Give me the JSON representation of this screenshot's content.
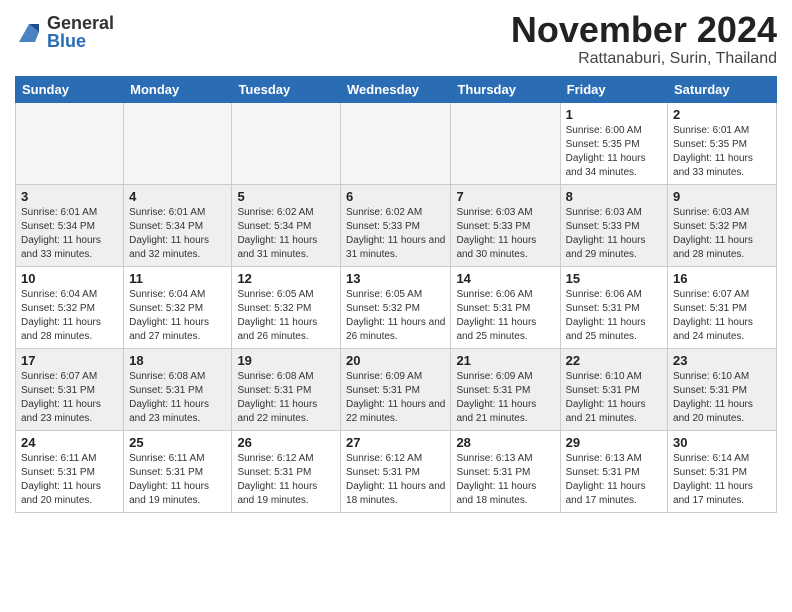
{
  "header": {
    "logo_general": "General",
    "logo_blue": "Blue",
    "month_title": "November 2024",
    "location": "Rattanaburi, Surin, Thailand"
  },
  "weekdays": [
    "Sunday",
    "Monday",
    "Tuesday",
    "Wednesday",
    "Thursday",
    "Friday",
    "Saturday"
  ],
  "rows": [
    {
      "row_class": "row-1",
      "cells": [
        {
          "empty": true
        },
        {
          "empty": true
        },
        {
          "empty": true
        },
        {
          "empty": true
        },
        {
          "empty": true
        },
        {
          "day": "1",
          "sunrise": "Sunrise: 6:00 AM",
          "sunset": "Sunset: 5:35 PM",
          "daylight": "Daylight: 11 hours and 34 minutes."
        },
        {
          "day": "2",
          "sunrise": "Sunrise: 6:01 AM",
          "sunset": "Sunset: 5:35 PM",
          "daylight": "Daylight: 11 hours and 33 minutes."
        }
      ]
    },
    {
      "row_class": "row-2",
      "cells": [
        {
          "day": "3",
          "sunrise": "Sunrise: 6:01 AM",
          "sunset": "Sunset: 5:34 PM",
          "daylight": "Daylight: 11 hours and 33 minutes."
        },
        {
          "day": "4",
          "sunrise": "Sunrise: 6:01 AM",
          "sunset": "Sunset: 5:34 PM",
          "daylight": "Daylight: 11 hours and 32 minutes."
        },
        {
          "day": "5",
          "sunrise": "Sunrise: 6:02 AM",
          "sunset": "Sunset: 5:34 PM",
          "daylight": "Daylight: 11 hours and 31 minutes."
        },
        {
          "day": "6",
          "sunrise": "Sunrise: 6:02 AM",
          "sunset": "Sunset: 5:33 PM",
          "daylight": "Daylight: 11 hours and 31 minutes."
        },
        {
          "day": "7",
          "sunrise": "Sunrise: 6:03 AM",
          "sunset": "Sunset: 5:33 PM",
          "daylight": "Daylight: 11 hours and 30 minutes."
        },
        {
          "day": "8",
          "sunrise": "Sunrise: 6:03 AM",
          "sunset": "Sunset: 5:33 PM",
          "daylight": "Daylight: 11 hours and 29 minutes."
        },
        {
          "day": "9",
          "sunrise": "Sunrise: 6:03 AM",
          "sunset": "Sunset: 5:32 PM",
          "daylight": "Daylight: 11 hours and 28 minutes."
        }
      ]
    },
    {
      "row_class": "row-3",
      "cells": [
        {
          "day": "10",
          "sunrise": "Sunrise: 6:04 AM",
          "sunset": "Sunset: 5:32 PM",
          "daylight": "Daylight: 11 hours and 28 minutes."
        },
        {
          "day": "11",
          "sunrise": "Sunrise: 6:04 AM",
          "sunset": "Sunset: 5:32 PM",
          "daylight": "Daylight: 11 hours and 27 minutes."
        },
        {
          "day": "12",
          "sunrise": "Sunrise: 6:05 AM",
          "sunset": "Sunset: 5:32 PM",
          "daylight": "Daylight: 11 hours and 26 minutes."
        },
        {
          "day": "13",
          "sunrise": "Sunrise: 6:05 AM",
          "sunset": "Sunset: 5:32 PM",
          "daylight": "Daylight: 11 hours and 26 minutes."
        },
        {
          "day": "14",
          "sunrise": "Sunrise: 6:06 AM",
          "sunset": "Sunset: 5:31 PM",
          "daylight": "Daylight: 11 hours and 25 minutes."
        },
        {
          "day": "15",
          "sunrise": "Sunrise: 6:06 AM",
          "sunset": "Sunset: 5:31 PM",
          "daylight": "Daylight: 11 hours and 25 minutes."
        },
        {
          "day": "16",
          "sunrise": "Sunrise: 6:07 AM",
          "sunset": "Sunset: 5:31 PM",
          "daylight": "Daylight: 11 hours and 24 minutes."
        }
      ]
    },
    {
      "row_class": "row-4",
      "cells": [
        {
          "day": "17",
          "sunrise": "Sunrise: 6:07 AM",
          "sunset": "Sunset: 5:31 PM",
          "daylight": "Daylight: 11 hours and 23 minutes."
        },
        {
          "day": "18",
          "sunrise": "Sunrise: 6:08 AM",
          "sunset": "Sunset: 5:31 PM",
          "daylight": "Daylight: 11 hours and 23 minutes."
        },
        {
          "day": "19",
          "sunrise": "Sunrise: 6:08 AM",
          "sunset": "Sunset: 5:31 PM",
          "daylight": "Daylight: 11 hours and 22 minutes."
        },
        {
          "day": "20",
          "sunrise": "Sunrise: 6:09 AM",
          "sunset": "Sunset: 5:31 PM",
          "daylight": "Daylight: 11 hours and 22 minutes."
        },
        {
          "day": "21",
          "sunrise": "Sunrise: 6:09 AM",
          "sunset": "Sunset: 5:31 PM",
          "daylight": "Daylight: 11 hours and 21 minutes."
        },
        {
          "day": "22",
          "sunrise": "Sunrise: 6:10 AM",
          "sunset": "Sunset: 5:31 PM",
          "daylight": "Daylight: 11 hours and 21 minutes."
        },
        {
          "day": "23",
          "sunrise": "Sunrise: 6:10 AM",
          "sunset": "Sunset: 5:31 PM",
          "daylight": "Daylight: 11 hours and 20 minutes."
        }
      ]
    },
    {
      "row_class": "row-5",
      "cells": [
        {
          "day": "24",
          "sunrise": "Sunrise: 6:11 AM",
          "sunset": "Sunset: 5:31 PM",
          "daylight": "Daylight: 11 hours and 20 minutes."
        },
        {
          "day": "25",
          "sunrise": "Sunrise: 6:11 AM",
          "sunset": "Sunset: 5:31 PM",
          "daylight": "Daylight: 11 hours and 19 minutes."
        },
        {
          "day": "26",
          "sunrise": "Sunrise: 6:12 AM",
          "sunset": "Sunset: 5:31 PM",
          "daylight": "Daylight: 11 hours and 19 minutes."
        },
        {
          "day": "27",
          "sunrise": "Sunrise: 6:12 AM",
          "sunset": "Sunset: 5:31 PM",
          "daylight": "Daylight: 11 hours and 18 minutes."
        },
        {
          "day": "28",
          "sunrise": "Sunrise: 6:13 AM",
          "sunset": "Sunset: 5:31 PM",
          "daylight": "Daylight: 11 hours and 18 minutes."
        },
        {
          "day": "29",
          "sunrise": "Sunrise: 6:13 AM",
          "sunset": "Sunset: 5:31 PM",
          "daylight": "Daylight: 11 hours and 17 minutes."
        },
        {
          "day": "30",
          "sunrise": "Sunrise: 6:14 AM",
          "sunset": "Sunset: 5:31 PM",
          "daylight": "Daylight: 11 hours and 17 minutes."
        }
      ]
    }
  ]
}
